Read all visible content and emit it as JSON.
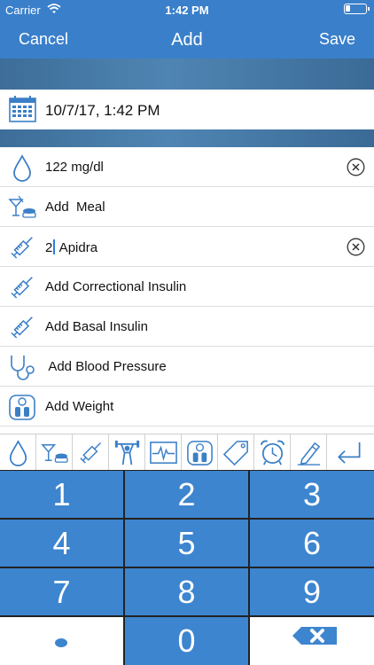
{
  "status_bar": {
    "carrier": "Carrier",
    "time": "1:42 PM",
    "battery_level": 0.25
  },
  "nav": {
    "cancel": "Cancel",
    "title": "Add",
    "save": "Save"
  },
  "date_row": {
    "value": "10/7/17, 1:42 PM",
    "icon": "calendar-icon"
  },
  "entries": [
    {
      "icon": "blood-drop-icon",
      "label": "122 mg/dl",
      "clearable": true
    },
    {
      "icon": "meal-icon",
      "label": "Add  Meal",
      "clearable": false
    },
    {
      "icon": "syringe-icon",
      "value_before_cursor": "2",
      "value_after_cursor": " Apidra",
      "clearable": true
    },
    {
      "icon": "syringe-icon",
      "label": "Add Correctional Insulin",
      "clearable": false
    },
    {
      "icon": "syringe-icon",
      "label": "Add Basal Insulin",
      "clearable": false
    },
    {
      "icon": "stethoscope-icon",
      "label": " Add Blood Pressure",
      "clearable": false
    },
    {
      "icon": "scale-icon",
      "label": "Add Weight",
      "clearable": false
    }
  ],
  "toolbar_icons": [
    "blood-drop-icon",
    "meal-icon",
    "syringe-icon",
    "exercise-icon",
    "heart-monitor-icon",
    "scale-icon",
    "tag-icon",
    "alarm-clock-icon",
    "note-pencil-icon",
    "return-icon"
  ],
  "keypad": {
    "keys": [
      "1",
      "2",
      "3",
      "4",
      "5",
      "6",
      "7",
      "8",
      "9",
      "•",
      "0",
      "⌫"
    ],
    "decimal_key": "•",
    "delete_key": "delete-icon"
  },
  "colors": {
    "accent": "#3a7fca",
    "key_blue": "#3d85cf",
    "icon_blue": "#3b7fc7"
  }
}
